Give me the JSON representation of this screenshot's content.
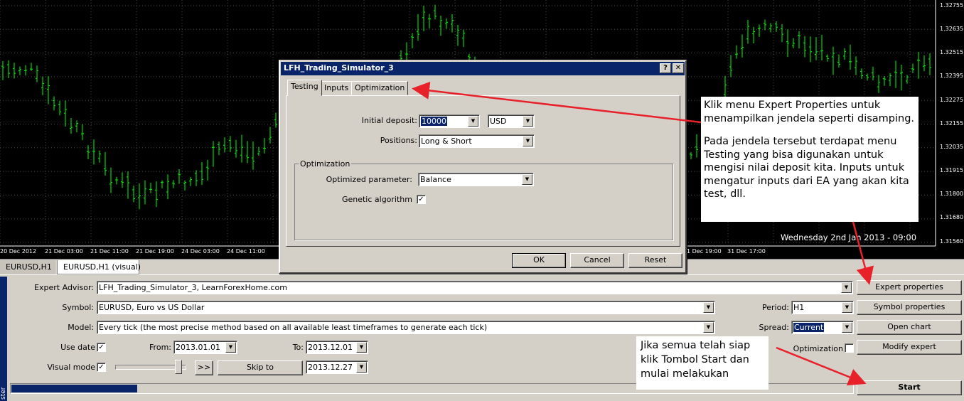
{
  "chart": {
    "prices": [
      "1.32755",
      "1.32635",
      "1.32515",
      "1.32395",
      "1.32275",
      "1.32155",
      "1.32035",
      "1.31915",
      "1.31800",
      "1.31680",
      "1.31560"
    ],
    "time_labels": [
      "20 Dec 2012",
      "21 Dec 03:00",
      "21 Dec 11:00",
      "21 Dec 19:00",
      "24 Dec 03:00",
      "24 Dec 11:00",
      "24 Dec 19:00",
      "1 Dec 19:00",
      "31 Dec 17:00"
    ],
    "datestamp": "Wednesday 2nd Jan 2013 - 09:00",
    "candle_color": "#00ff00",
    "bg_color": "#000000"
  },
  "chart_tabs": [
    "EURUSD,H1",
    "EURUSD,H1 (visual)"
  ],
  "tester": {
    "side_label": "ster",
    "expert_advisor_label": "Expert Advisor:",
    "expert_advisor_value": "LFH_Trading_Simulator_3, LearnForexHome.com",
    "symbol_label": "Symbol:",
    "symbol_value": "EURUSD, Euro vs US Dollar",
    "model_label": "Model:",
    "model_value": "Every tick (the most precise method based on all available least timeframes to generate each tick)",
    "use_date_label": "Use date",
    "use_date_checked": "✓",
    "from_label": "From:",
    "from_value": "2013.01.01",
    "to_label": "To:",
    "to_value": "2013.12.01",
    "visual_mode_label": "Visual mode",
    "visual_mode_checked": "✓",
    "ff_button": ">>",
    "skip_to_button": "Skip to",
    "skip_to_value": "2013.12.27",
    "period_label": "Period:",
    "period_value": "H1",
    "spread_label": "Spread:",
    "spread_value": "Current",
    "optimization_label": "Optimization",
    "buttons": {
      "expert_properties": "Expert properties",
      "symbol_properties": "Symbol properties",
      "open_chart": "Open chart",
      "modify_expert": "Modify expert",
      "start": "Start"
    },
    "progress": 0.15
  },
  "dialog": {
    "title": "LFH_Trading_Simulator_3",
    "help_button": "?",
    "close_button": "✕",
    "tabs": [
      "Testing",
      "Inputs",
      "Optimization"
    ],
    "initial_deposit_label": "Initial deposit:",
    "initial_deposit_value": "10000",
    "currency_value": "USD",
    "positions_label": "Positions:",
    "positions_value": "Long & Short",
    "optimization_group": "Optimization",
    "optimized_parameter_label": "Optimized parameter:",
    "optimized_parameter_value": "Balance",
    "genetic_algorithm_label": "Genetic algorithm",
    "genetic_algorithm_checked": "✓",
    "ok": "OK",
    "cancel": "Cancel",
    "reset": "Reset"
  },
  "callouts": {
    "top_line1": "Klik menu Expert Properties untuk",
    "top_line2": "menampilkan jendela seperti disamping.",
    "top_para2_line1": "Pada jendela tersebut terdapat menu",
    "top_para2_line2": "Testing yang bisa digunakan untuk",
    "top_para2_line3": "mengisi nilai deposit kita. Inputs untuk",
    "top_para2_line4": "mengatur inputs dari EA yang akan kita",
    "top_para2_line5": "test, dll.",
    "bottom_line1": "Jika semua telah siap",
    "bottom_line2": "klik Tombol Start dan",
    "bottom_line3": "mulai melakukan",
    "arrow_color": "#e8202a"
  }
}
